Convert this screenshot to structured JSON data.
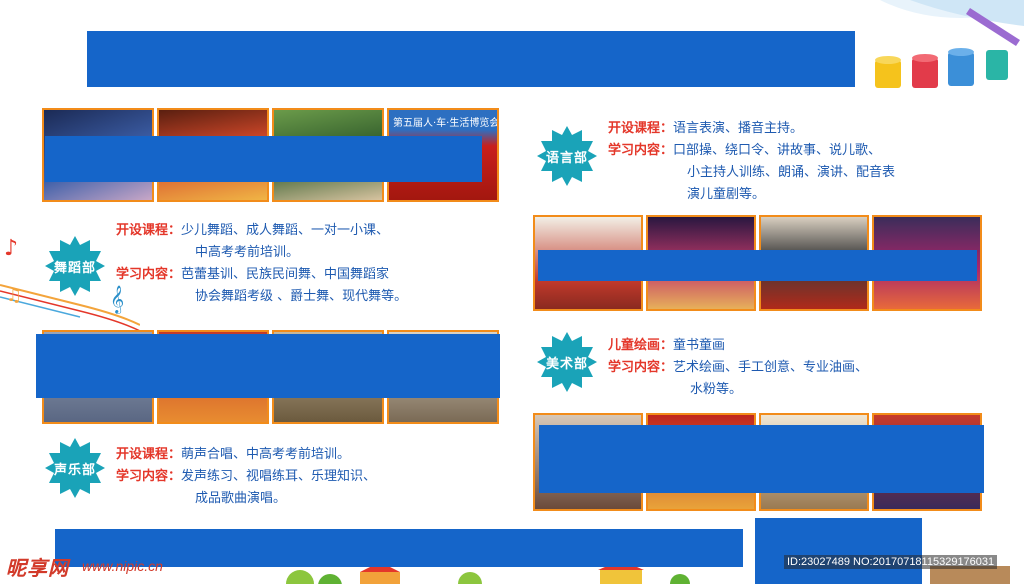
{
  "colors": {
    "accent_blue": "#1565c9",
    "label_red": "#e4372a",
    "text_blue": "#1e5ab0",
    "badge_cyan": "#1aa3b8",
    "photo_border": "#f28c1a"
  },
  "photo_banner_text": "第五届人·车·生活博览会",
  "dance": {
    "badge": "舞蹈部",
    "course_label": "开设课程：",
    "course_lines": [
      "少儿舞蹈、成人舞蹈、一对一小课、",
      "中高考考前培训。"
    ],
    "study_label": "学习内容：",
    "study_lines": [
      "芭蕾基训、民族民间舞、中国舞蹈家",
      "协会舞蹈考级 、爵士舞、现代舞等。"
    ]
  },
  "vocal": {
    "badge": "声乐部",
    "course_label": "开设课程：",
    "course_lines": [
      "萌声合唱、中高考考前培训。"
    ],
    "study_label": "学习内容：",
    "study_lines": [
      "发声练习、视唱练耳、乐理知识、",
      "成品歌曲演唱。"
    ]
  },
  "language": {
    "badge": "语言部",
    "course_label": "开设课程：",
    "course_lines": [
      "语言表演、播音主持。"
    ],
    "study_label": "学习内容：",
    "study_lines": [
      "口部操、绕口令、讲故事、说儿歌、",
      "小主持人训练、朗诵、演讲、配音表",
      "演儿童剧等。"
    ]
  },
  "art": {
    "badge": "美术部",
    "course_label": "儿童绘画：",
    "course_lines": [
      "童书童画"
    ],
    "study_label": "学习内容：",
    "study_lines": [
      "艺术绘画、手工创意、专业油画、",
      "水粉等。"
    ]
  },
  "watermark": {
    "logo": "昵享网",
    "url": "www.nipic.cn",
    "id_text": "ID:23027489 NO:20170718115329176031"
  }
}
